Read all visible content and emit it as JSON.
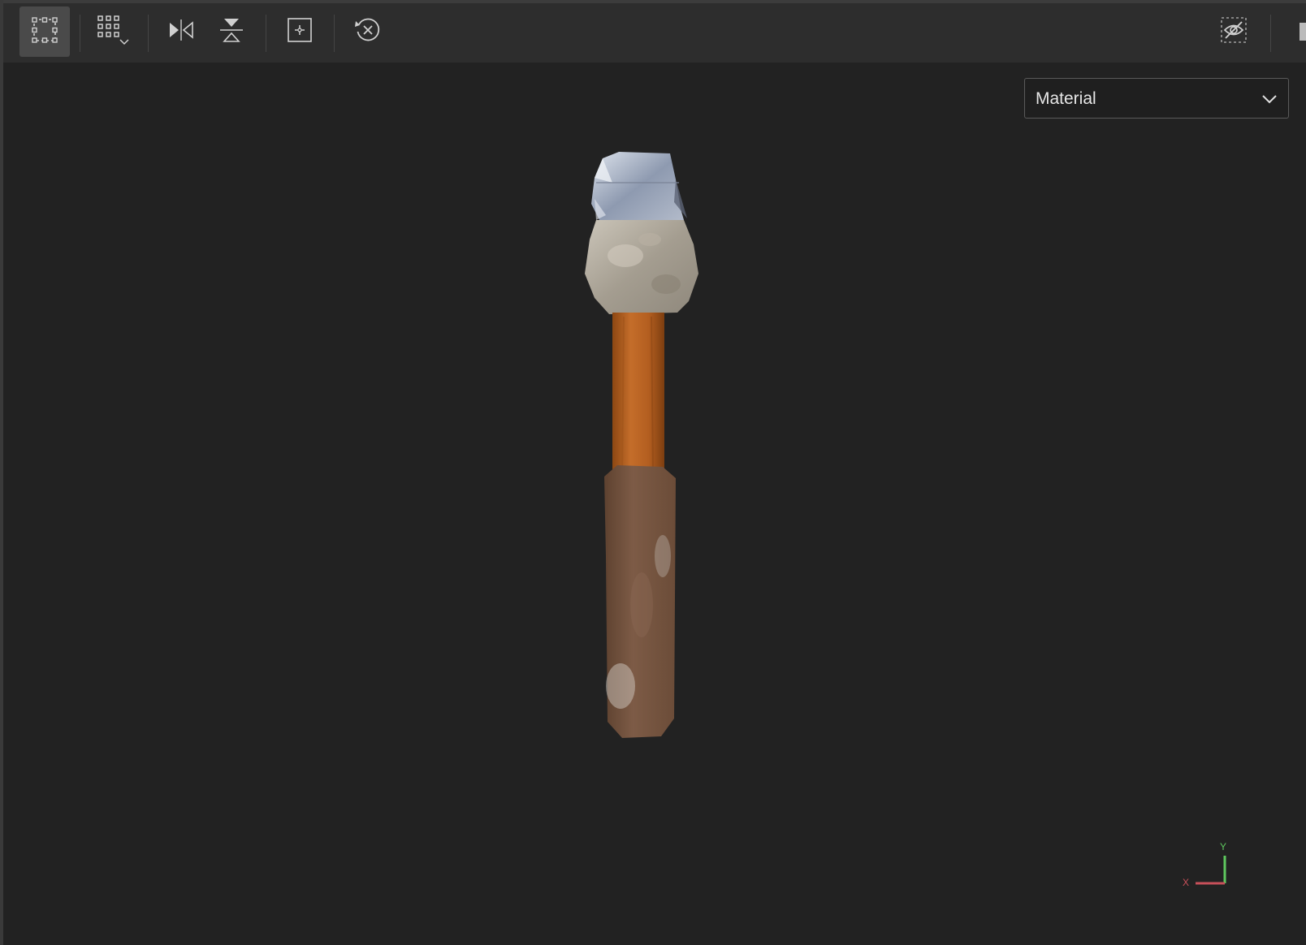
{
  "toolbar": {
    "buttons": [
      {
        "name": "select-frame-icon",
        "active": true
      },
      {
        "name": "grid-options-icon",
        "active": false
      },
      {
        "name": "mirror-horizontal-icon",
        "active": false
      },
      {
        "name": "mirror-vertical-icon",
        "active": false
      },
      {
        "name": "frame-selection-icon",
        "active": false
      },
      {
        "name": "reset-view-icon",
        "active": false
      },
      {
        "name": "visibility-off-icon",
        "active": false
      }
    ]
  },
  "viewport": {
    "shading_dropdown": {
      "selected": "Material"
    },
    "model": "hammer",
    "axis_gizmo": {
      "x_label": "X",
      "y_label": "Y"
    }
  },
  "colors": {
    "background": "#222222",
    "toolbar": "#2d2d2d",
    "active_button": "#4a4a4a",
    "icon": "#d0d0d0",
    "axis_x": "#c8505a",
    "axis_y": "#5fc85f"
  }
}
